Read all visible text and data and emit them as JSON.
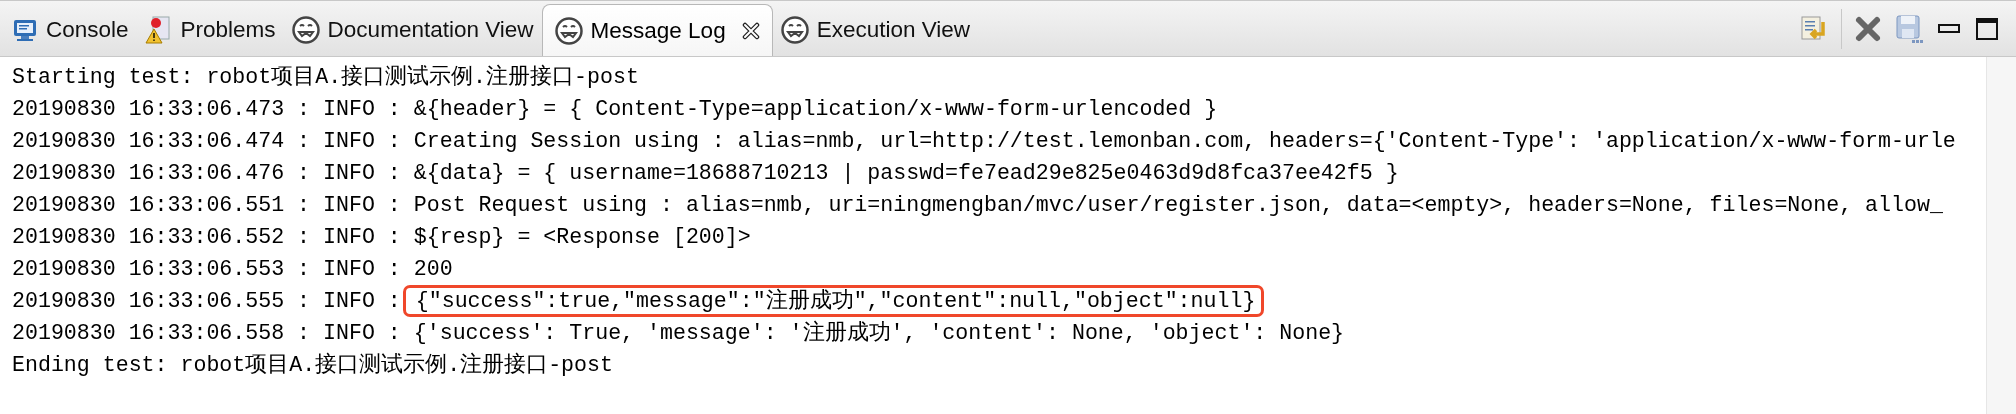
{
  "tabs": [
    {
      "label": "Console",
      "kind": "console",
      "selected": false,
      "closable": false
    },
    {
      "label": "Problems",
      "kind": "problems",
      "selected": false,
      "closable": false
    },
    {
      "label": "Documentation View",
      "kind": "robot",
      "selected": false,
      "closable": false
    },
    {
      "label": "Message Log",
      "kind": "robot",
      "selected": true,
      "closable": true
    },
    {
      "label": "Execution View",
      "kind": "robot",
      "selected": false,
      "closable": false
    }
  ],
  "toolbar": [
    {
      "kind": "wrap"
    },
    {
      "kind": "separator"
    },
    {
      "kind": "clear"
    },
    {
      "kind": "save"
    },
    {
      "kind": "minimize"
    },
    {
      "kind": "maximize"
    }
  ],
  "lines": [
    {
      "kind": "plain",
      "text": "Starting test: robot项目A.接口测试示例.注册接口-post"
    },
    {
      "kind": "log",
      "prefix": "20190830 16:33:06.473 : INFO :",
      "message": "&{header} = { Content-Type=application/x-www-form-urlencoded }",
      "highlighted": false
    },
    {
      "kind": "log",
      "prefix": "20190830 16:33:06.474 : INFO :",
      "message": "Creating Session using : alias=nmb, url=http://test.lemonban.com, headers={'Content-Type': 'application/x-www-form-urle",
      "highlighted": false
    },
    {
      "kind": "log",
      "prefix": "20190830 16:33:06.476 : INFO :",
      "message": "&{data} = { username=18688710213 | passwd=fe7ead29e825e0463d9d8fca37ee42f5 }",
      "highlighted": false
    },
    {
      "kind": "log",
      "prefix": "20190830 16:33:06.551 : INFO :",
      "message": "Post Request using : alias=nmb, uri=ningmengban/mvc/user/register.json, data=<empty>, headers=None, files=None, allow_",
      "highlighted": false
    },
    {
      "kind": "log",
      "prefix": "20190830 16:33:06.552 : INFO :",
      "message": "${resp} = <Response [200]>",
      "highlighted": false
    },
    {
      "kind": "log",
      "prefix": "20190830 16:33:06.553 : INFO :",
      "message": "200",
      "highlighted": false
    },
    {
      "kind": "log",
      "prefix": "20190830 16:33:06.555 : INFO :",
      "message": "{\"success\":true,\"message\":\"注册成功\",\"content\":null,\"object\":null}",
      "highlighted": true
    },
    {
      "kind": "log",
      "prefix": "20190830 16:33:06.558 : INFO :",
      "message": "{'success': True, 'message': '注册成功', 'content': None, 'object': None}",
      "highlighted": false
    },
    {
      "kind": "plain",
      "text": "Ending test: robot项目A.接口测试示例.注册接口-post"
    }
  ]
}
